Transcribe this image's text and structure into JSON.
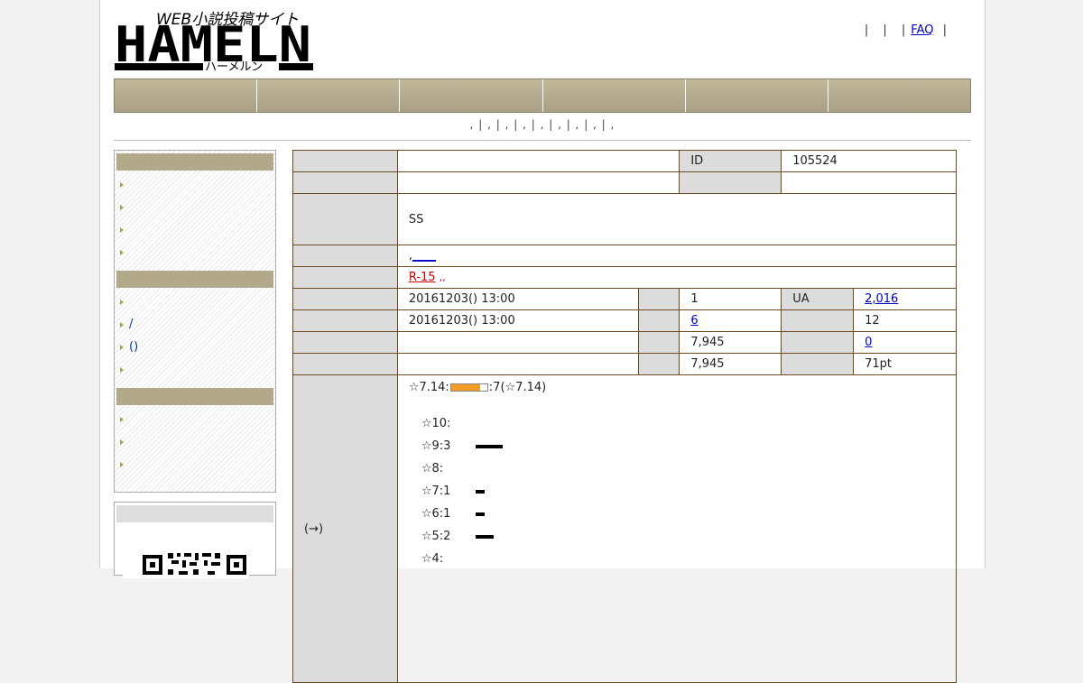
{
  "site": {
    "logo_text": "HAMELN",
    "logo_tagline": "WEB小説投稿サイト",
    "logo_kana": "ハーメルン"
  },
  "top_links": {
    "faq": "FAQ"
  },
  "nav": {
    "subnav": ", | , | , | , | , | , | , | , | ,"
  },
  "info": {
    "id_label": "ID",
    "id_value": "105524",
    "genre": "SS",
    "tags_lead": ",",
    "tags_link": "____",
    "r15_label": "R-15",
    "r15_trail": ",,",
    "first_post": "20161203() 13:00",
    "episodes": "1",
    "ua_label": "UA",
    "ua_value": "2,016",
    "last_update": "20161203() 13:00",
    "favorites": "6",
    "reviews": "12",
    "chars": "7,945",
    "comments": "0",
    "avg_chars": "7,945",
    "points": "71pt",
    "rating_label": "(→)",
    "rating_prefix": "☆7.14:",
    "rating_suffix": ":7(☆7.14)",
    "rating_fill": 0.8
  },
  "rating_dist": [
    {
      "label": "☆10:",
      "count": 0
    },
    {
      "label": "☆9:3",
      "count": 3
    },
    {
      "label": "☆8:",
      "count": 0
    },
    {
      "label": "☆7:1",
      "count": 1
    },
    {
      "label": "☆6:1",
      "count": 1
    },
    {
      "label": "☆5:2",
      "count": 2
    },
    {
      "label": "☆4:",
      "count": 0
    }
  ]
}
